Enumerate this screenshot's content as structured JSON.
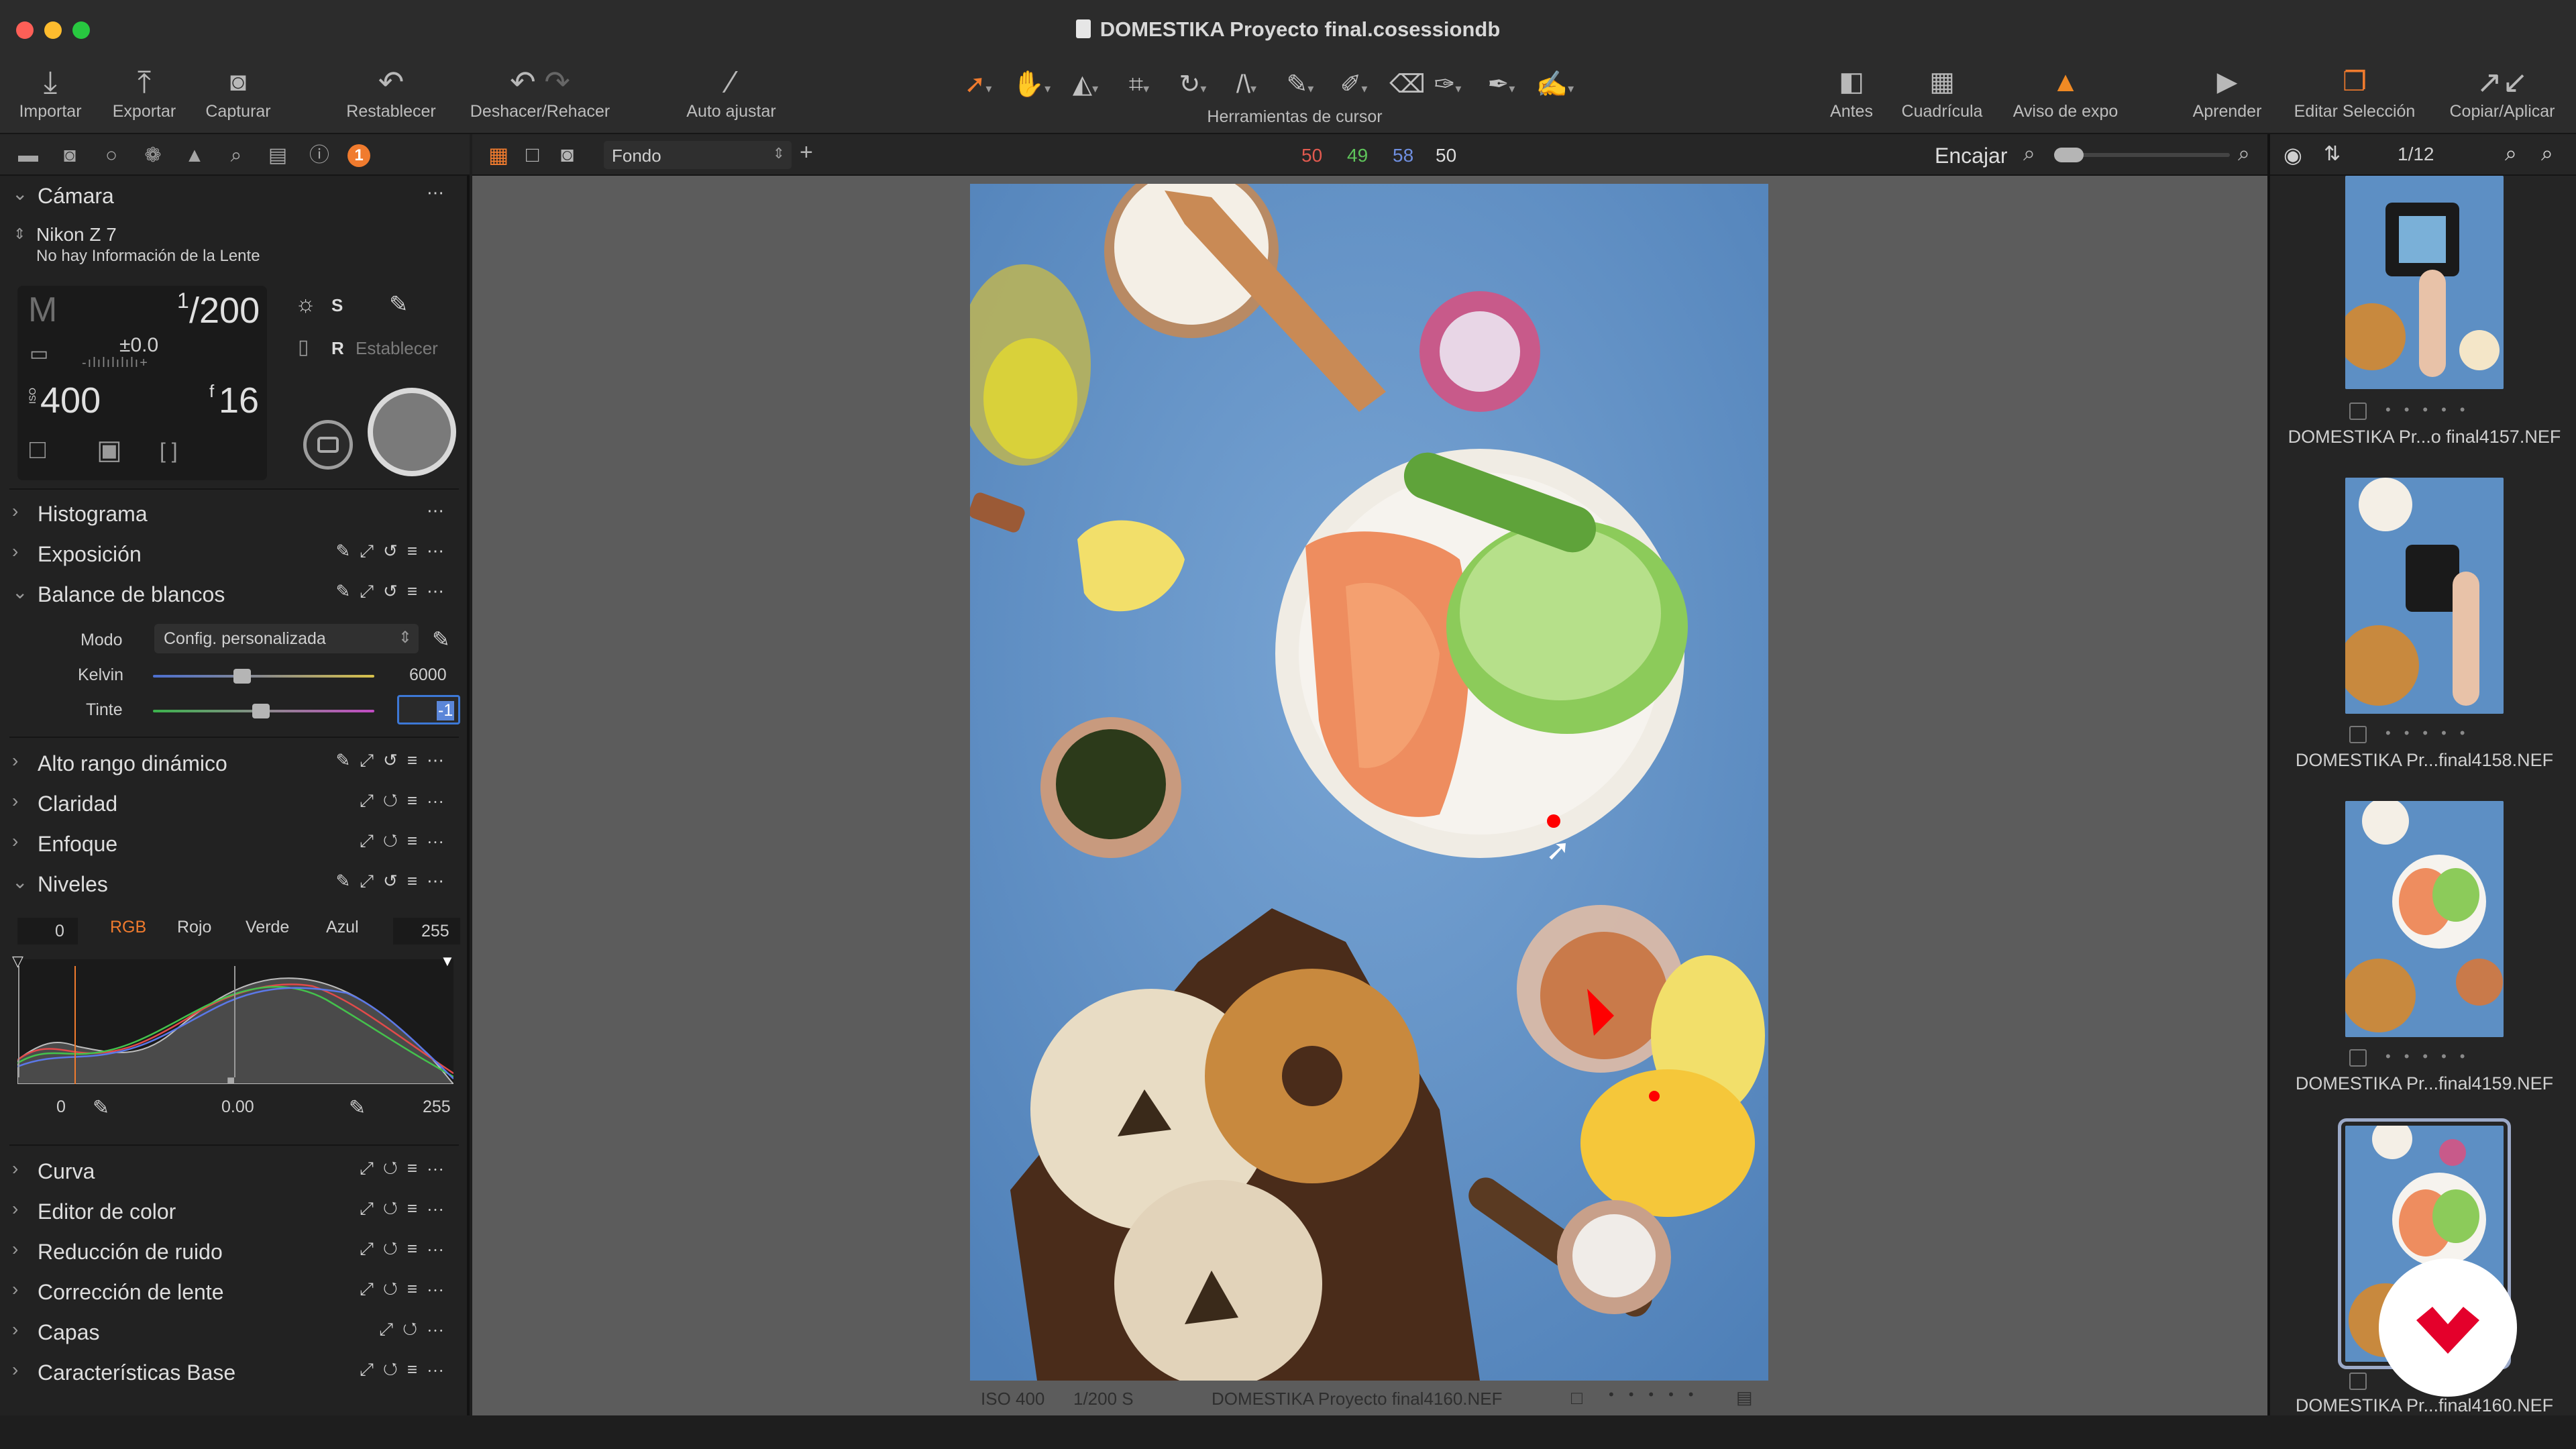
{
  "window": {
    "title": "DOMESTIKA Proyecto final.cosessiondb"
  },
  "toolbar": {
    "import": "Importar",
    "export": "Exportar",
    "capture": "Capturar",
    "reset": "Restablecer",
    "undo_redo": "Deshacer/Rehacer",
    "auto_adjust": "Auto ajustar",
    "cursor_tools": "Herramientas de cursor",
    "before": "Antes",
    "grid": "Cuadrícula",
    "exposure_warning": "Aviso de expo",
    "learn": "Aprender",
    "edit_selection": "Editar Selección",
    "copy_apply": "Copiar/Aplicar"
  },
  "left_tabs": {
    "badge": "1"
  },
  "camera": {
    "section": "Cámara",
    "model": "Nikon Z 7",
    "lens": "No hay Información de la Lente",
    "mode": "M",
    "shutter_num": "1",
    "shutter_den": "200",
    "ev": "±0.0",
    "iso_label": "ISO",
    "iso": "400",
    "aperture_prefix": "f",
    "aperture": "16",
    "wb": "S",
    "raw": "R",
    "set": "Establecer"
  },
  "sections": {
    "histogram": "Histograma",
    "exposure": "Exposición",
    "white_balance": "Balance de blancos",
    "hdr": "Alto rango dinámico",
    "clarity": "Claridad",
    "sharpening": "Enfoque",
    "levels": "Niveles",
    "curve": "Curva",
    "color_editor": "Editor de color",
    "noise_reduction": "Reducción de ruido",
    "lens_correction": "Corrección de lente",
    "layers": "Capas",
    "base_characteristics": "Características Base"
  },
  "white_balance": {
    "mode_label": "Modo",
    "mode_value": "Config. personalizada",
    "kelvin_label": "Kelvin",
    "kelvin_value": "6000",
    "tint_label": "Tinte",
    "tint_value": "-1"
  },
  "levels": {
    "left_value": "0",
    "right_value": "255",
    "channels": [
      "RGB",
      "Rojo",
      "Verde",
      "Azul"
    ],
    "output_low": "0",
    "midpoint": "0.00",
    "output_high": "255"
  },
  "viewer_bar": {
    "background_label": "Fondo",
    "r": "50",
    "g": "49",
    "b": "58",
    "l": "50",
    "fit": "Encajar"
  },
  "viewer_status": {
    "iso": "ISO 400",
    "shutter": "1/200 S",
    "filename": "DOMESTIKA Proyecto final4160.NEF"
  },
  "browser": {
    "counter": "1/12",
    "thumbnails": [
      {
        "name": "DOMESTIKA Pr...o final4157.NEF"
      },
      {
        "name": "DOMESTIKA Pr...final4158.NEF"
      },
      {
        "name": "DOMESTIKA Pr...final4159.NEF"
      },
      {
        "name": "DOMESTIKA Pr...final4160.NEF"
      }
    ]
  },
  "colors": {
    "accent": "#f07b2e",
    "warning": "#f08a24",
    "readout_red": "#e25a4f",
    "readout_green": "#5ec45a",
    "readout_blue": "#6f8fe0",
    "photo_background": "#5d8fc4",
    "domestika_red": "#e4002b"
  }
}
